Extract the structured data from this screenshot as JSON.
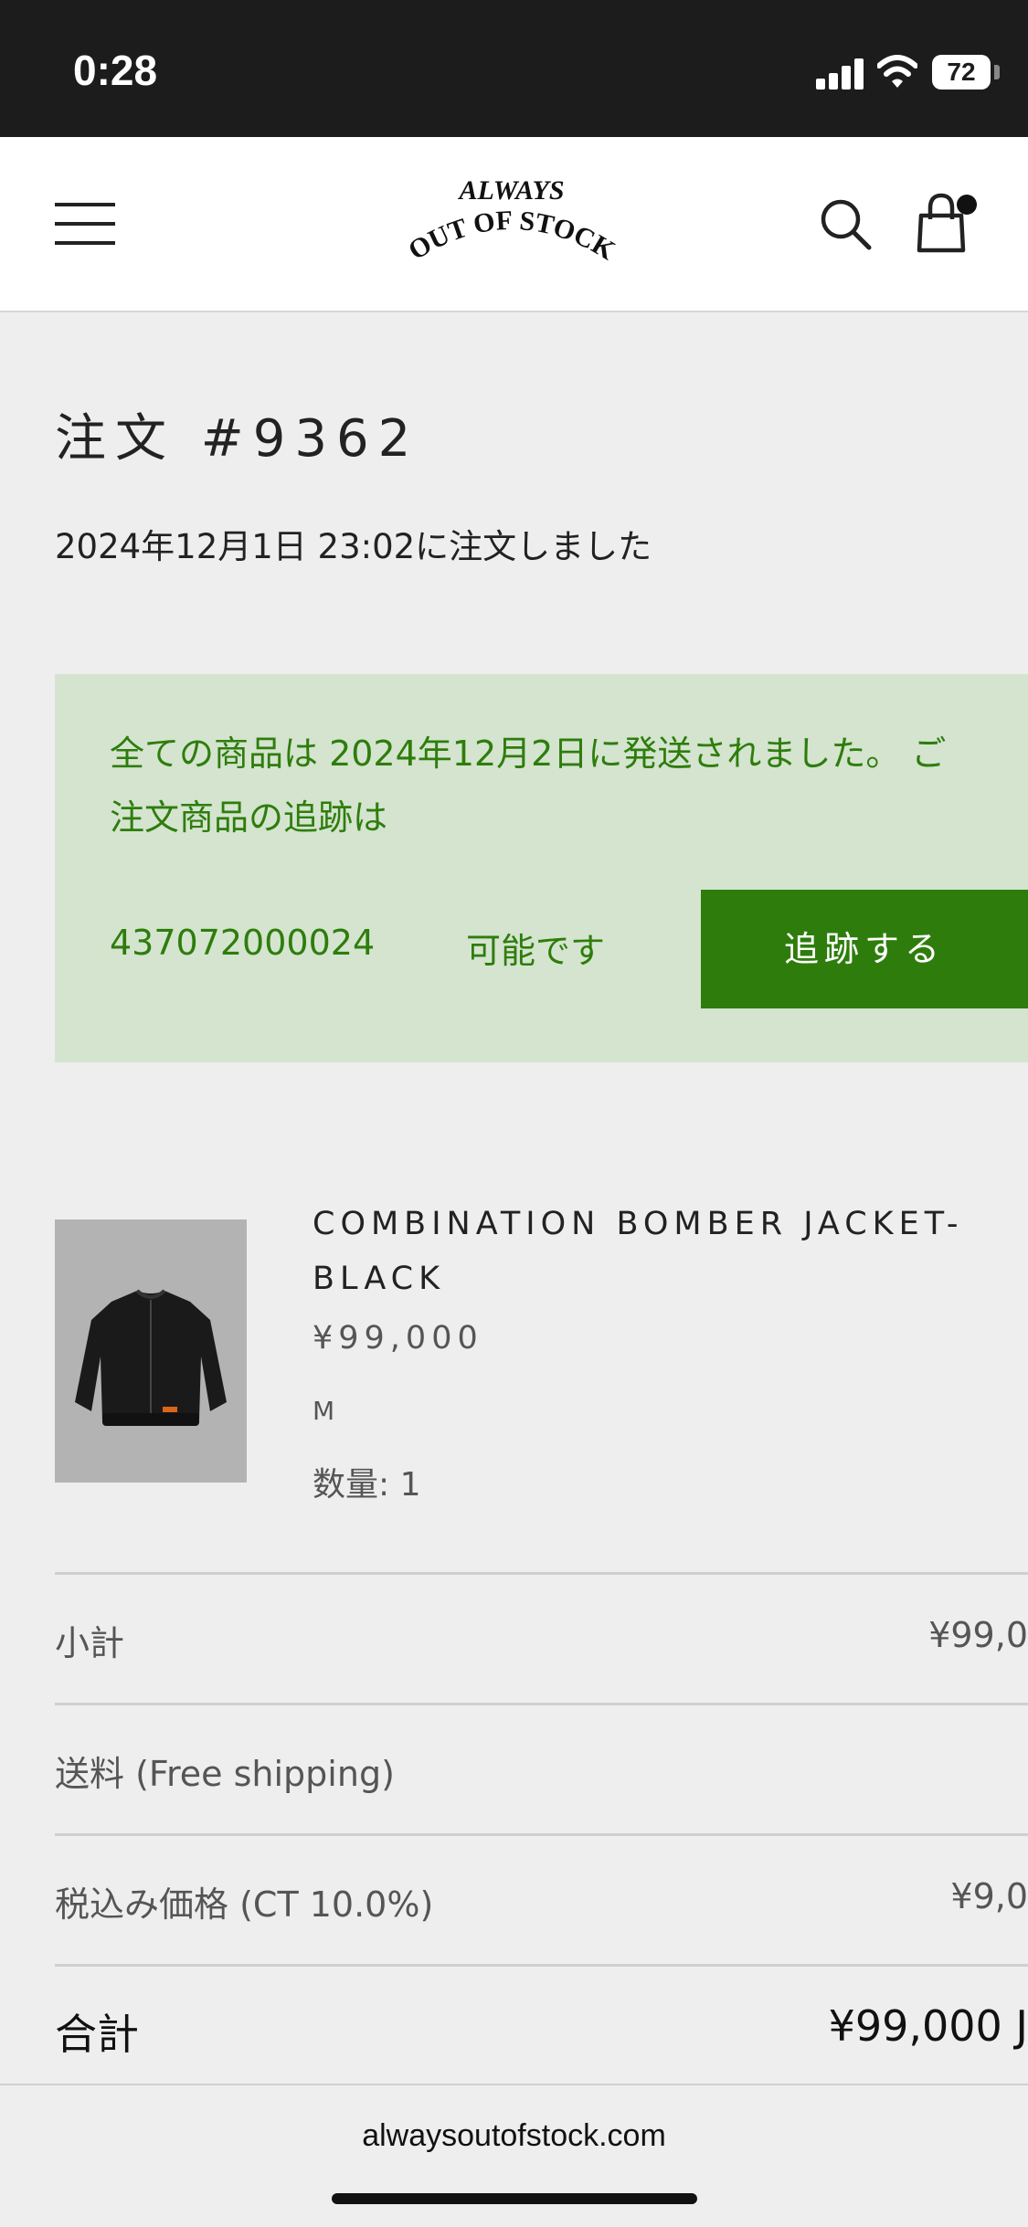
{
  "status_bar": {
    "time": "0:28",
    "battery": "72"
  },
  "header": {
    "logo_line1": "ALWAYS",
    "logo_line2": "OUT OF STOCK"
  },
  "order": {
    "title": "注文 #9362",
    "placed_at": "2024年12月1日 23:02に注文しました"
  },
  "shipping": {
    "message_line1": "全ての商品は 2024年12月2日に発送されました。 ご",
    "message_line2": "注文商品の追跡は",
    "tracking_number": "437072000024",
    "available_text": "可能です",
    "track_button": "追跡する"
  },
  "item": {
    "name": "COMBINATION BOMBER JACKET-BLACK",
    "price": "¥99,000",
    "size": "M",
    "quantity": "数量: 1"
  },
  "summary": {
    "subtotal_label": "小計",
    "subtotal_value": "¥99,0",
    "shipping_label": "送料 (Free shipping)",
    "tax_label": "税込み価格 (CT 10.0%)",
    "tax_value": "¥9,0",
    "total_label": "合計",
    "total_value": "¥99,000 J"
  },
  "footer": {
    "url": "alwaysoutofstock.com"
  }
}
